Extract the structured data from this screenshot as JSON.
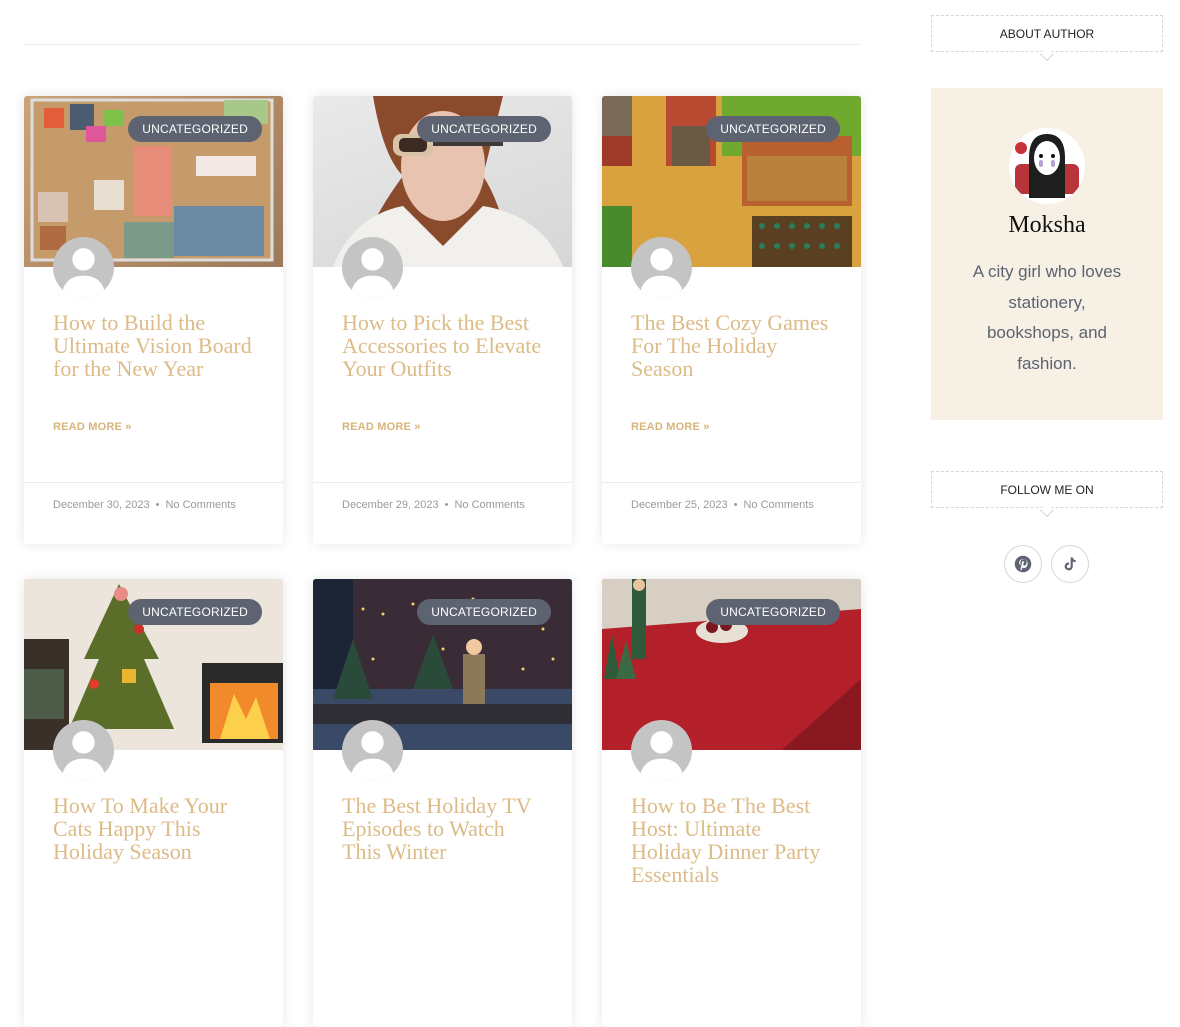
{
  "posts": [
    {
      "category": "UNCATEGORIZED",
      "title": "How to Build the Ultimate Vision Board for the New Year",
      "read_more": "READ MORE »",
      "date": "December 30, 2023",
      "separator": "•",
      "comments": "No Comments",
      "image": "vision-board-cork"
    },
    {
      "category": "UNCATEGORIZED",
      "title": "How to Pick the Best Accessories to Elevate Your Outfits",
      "read_more": "READ MORE »",
      "date": "December 29, 2023",
      "separator": "•",
      "comments": "No Comments",
      "image": "woman-sunglasses"
    },
    {
      "category": "UNCATEGORIZED",
      "title": "The Best Cozy Games For The Holiday Season",
      "read_more": "READ MORE »",
      "date": "December 25, 2023",
      "separator": "•",
      "comments": "No Comments",
      "image": "pixel-farm-game"
    },
    {
      "category": "UNCATEGORIZED",
      "title": "How To Make Your Cats Happy This Holiday Season",
      "image": "felt-christmas-tree"
    },
    {
      "category": "UNCATEGORIZED",
      "title": "The Best Holiday TV Episodes to Watch This Winter",
      "image": "cartoon-snowy-night"
    },
    {
      "category": "UNCATEGORIZED",
      "title": "How to Be The Best Host: Ultimate Holiday Dinner Party Essentials",
      "image": "red-tablecloth-dinner"
    }
  ],
  "sidebar": {
    "about_heading": "ABOUT AUTHOR",
    "author_name": "Moksha",
    "author_bio": "A city girl who loves stationery, bookshops, and fashion.",
    "follow_heading": "FOLLOW ME ON",
    "socials": [
      {
        "name": "pinterest",
        "icon": "pinterest-icon"
      },
      {
        "name": "tiktok",
        "icon": "tiktok-icon"
      }
    ]
  },
  "colors": {
    "title_gold": "#dcbb86",
    "badge_bg": "#5d6370",
    "author_bg": "#f6f0e5"
  }
}
